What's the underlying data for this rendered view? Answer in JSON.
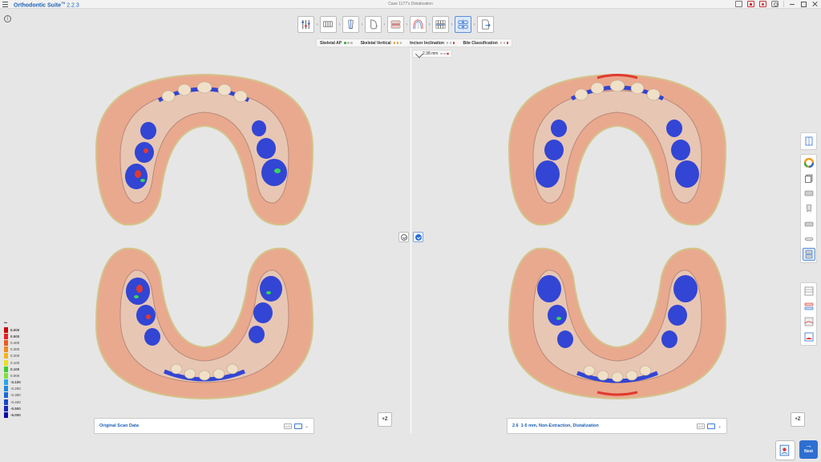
{
  "app": {
    "name": "Orthodontic Suite",
    "edition": "TS",
    "version": "2.2.3",
    "case_title": "Case 1177's Distalization"
  },
  "info_label": "i",
  "stepper": {
    "arrow": "›",
    "steps": [
      {
        "name": "step-setup",
        "active": false
      },
      {
        "name": "step-segmentation",
        "active": false
      },
      {
        "name": "step-tooth-axis",
        "active": false
      },
      {
        "name": "step-face",
        "active": false
      },
      {
        "name": "step-bite",
        "active": false
      },
      {
        "name": "step-arch-form",
        "active": false
      },
      {
        "name": "step-alignment",
        "active": false
      },
      {
        "name": "step-distalization",
        "active": true
      },
      {
        "name": "step-export",
        "active": false
      }
    ]
  },
  "indicators": [
    {
      "label": "Skeletal AP",
      "dots": [
        "#3caa3c",
        "#bbbbbb",
        "#bbbbbb"
      ]
    },
    {
      "label": "Skeletal Vertical",
      "dots": [
        "#e8a020",
        "#e8a020",
        "#bbbbbb"
      ]
    },
    {
      "label": "Incisor Inclination",
      "dots": [
        "#bbbbbb",
        "#bbbbbb",
        "#d33030"
      ]
    },
    {
      "label": "Bite Classification",
      "dots": [
        "#bbbbbb",
        "#bbbbbb",
        "#d33030"
      ]
    }
  ],
  "measurement": {
    "value": "2.38 mm",
    "dots": [
      "#bbbbbb",
      "#bbbbbb",
      "#d33030"
    ]
  },
  "panels": {
    "left": {
      "label": "Original Scan Data",
      "number": ""
    },
    "right": {
      "label": "1-5 mm, Non-Extraction, Distalization",
      "number": "2.6"
    }
  },
  "panel_icon_label": "A/B",
  "panel_chevron": "⌄",
  "z_button": "+Z",
  "legend": {
    "items": [
      {
        "value": "5.000",
        "color": "#cc0000",
        "bold": true
      },
      {
        "value": "0.500",
        "color": "#e52020",
        "bold": true
      },
      {
        "value": "0.400",
        "color": "#ee5a1a",
        "bold": false
      },
      {
        "value": "0.300",
        "color": "#f48a18",
        "bold": false
      },
      {
        "value": "0.200",
        "color": "#f6b41a",
        "bold": false
      },
      {
        "value": "0.100",
        "color": "#e8e01a",
        "bold": false
      },
      {
        "value": "0.100",
        "color": "#3ecc2a",
        "bold": true
      },
      {
        "value": "0.000",
        "color": "#7ee03a",
        "bold": false
      },
      {
        "value": "-0.100",
        "color": "#23a8e8",
        "bold": true
      },
      {
        "value": "-0.200",
        "color": "#1e8ae0",
        "bold": false
      },
      {
        "value": "-0.300",
        "color": "#1a6ad6",
        "bold": false
      },
      {
        "value": "-0.400",
        "color": "#1648cc",
        "bold": false
      },
      {
        "value": "-0.500",
        "color": "#1228c0",
        "bold": true
      },
      {
        "value": "-5.000",
        "color": "#0a0aa0",
        "bold": true
      }
    ]
  },
  "next_label": "Next",
  "next_arrow": "→"
}
